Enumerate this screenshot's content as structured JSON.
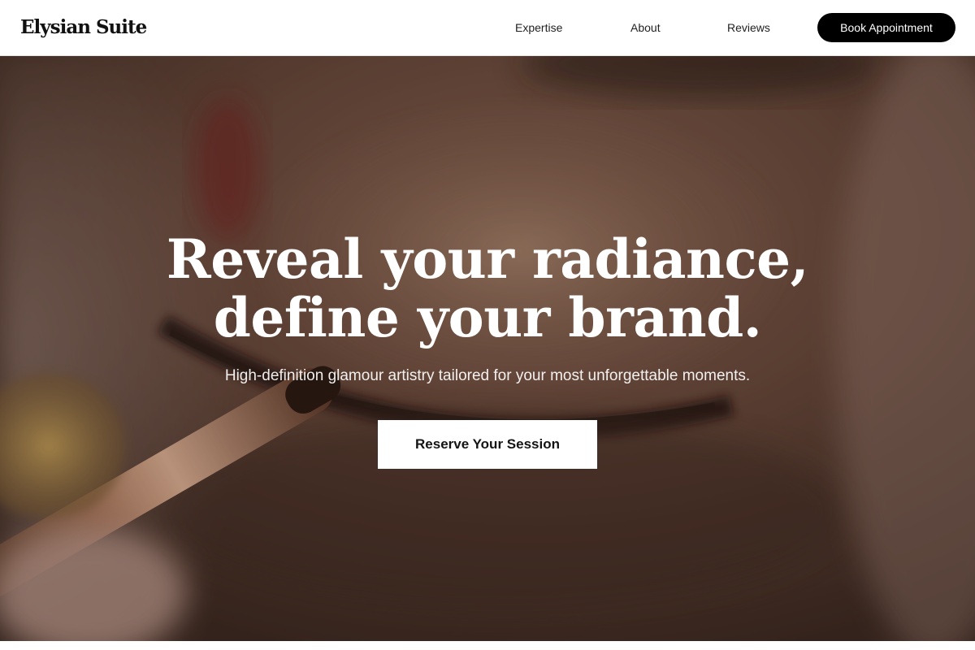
{
  "header": {
    "brand": "Elysian Suite",
    "nav": {
      "expertise": "Expertise",
      "about": "About",
      "reviews": "Reviews"
    },
    "book_button": "Book Appointment"
  },
  "hero": {
    "title_line1": "Reveal your radiance,",
    "title_line2": "define your brand.",
    "subtitle": "High-definition glamour artistry tailored for your most unforgettable moments.",
    "cta": "Reserve Your Session",
    "image_subject": "close-up-eye-makeup-brush"
  },
  "colors": {
    "header_bg": "#ffffff",
    "brand_text": "#111111",
    "book_button_bg": "#000000",
    "cta_bg": "#ffffff",
    "skin_tone": "#7a5646"
  }
}
